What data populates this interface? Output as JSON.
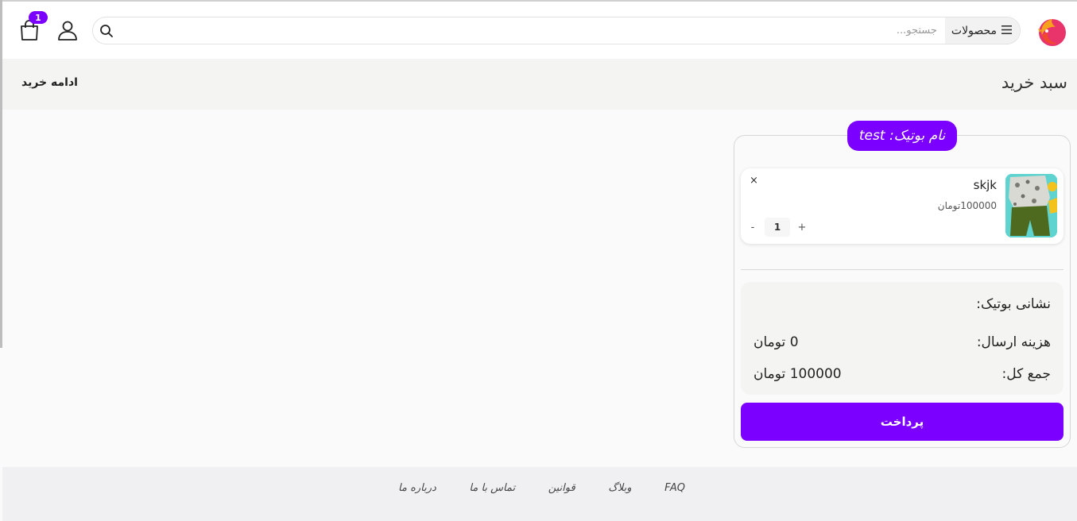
{
  "header": {
    "category_button": "محصولات",
    "search_placeholder": "جستجو...",
    "cart_count": "1"
  },
  "title_bar": {
    "title": "سبد خرید",
    "continue_link": "ادامه خرید"
  },
  "cart": {
    "boutique_label": "نام بوتیک: test",
    "items": [
      {
        "name": "skjk",
        "price": "100000تومان",
        "quantity": "1",
        "remove": "×",
        "increment": "+",
        "decrement": "-"
      }
    ],
    "summary": {
      "address_label": "نشانی بوتیک:",
      "shipping_label": "هزینه ارسال:",
      "shipping_value": "0 تومان",
      "total_label": "جمع کل:",
      "total_value": "100000 تومان"
    },
    "pay_button": "پرداخت"
  },
  "footer": {
    "links": [
      "درباره ما",
      "تماس با ما",
      "قوانین",
      "وبلاگ",
      "FAQ"
    ]
  },
  "colors": {
    "accent": "#7b00ff",
    "page_bg": "#fafafa",
    "titlebar_bg": "#f4f4f3",
    "footer_bg": "#f0f0f2"
  },
  "icons": [
    "logo-icon",
    "menu-icon",
    "search-icon",
    "user-icon",
    "cart-icon"
  ]
}
